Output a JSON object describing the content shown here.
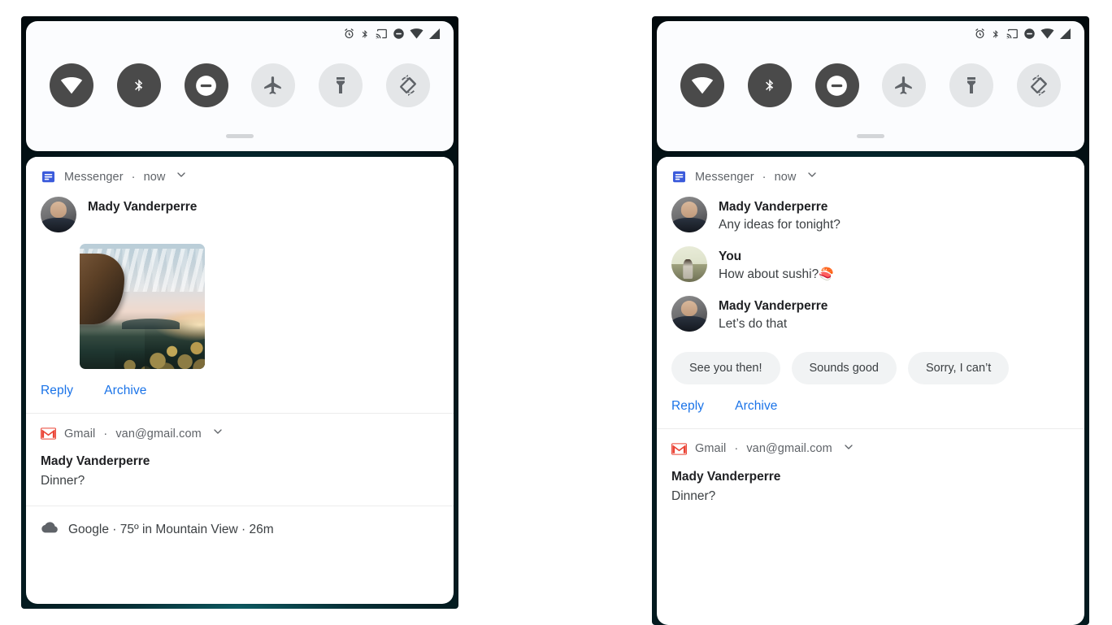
{
  "status_bar": {
    "icons": [
      "alarm-icon",
      "bluetooth-icon",
      "cast-icon",
      "do-not-disturb-icon",
      "wifi-icon",
      "signal-icon"
    ]
  },
  "quick_settings": {
    "tiles": [
      {
        "name": "wifi",
        "label": "Wi-Fi",
        "state": "on"
      },
      {
        "name": "bluetooth",
        "label": "Bluetooth",
        "state": "on"
      },
      {
        "name": "dnd",
        "label": "Do Not Disturb",
        "state": "on"
      },
      {
        "name": "airplane",
        "label": "Airplane mode",
        "state": "off"
      },
      {
        "name": "flashlight",
        "label": "Flashlight",
        "state": "off"
      },
      {
        "name": "auto-rotate",
        "label": "Auto-rotate",
        "state": "off"
      }
    ],
    "handle": "drag-handle"
  },
  "left_panel": {
    "messenger": {
      "app_name": "Messenger",
      "separator": "·",
      "time": "now",
      "sender": "Mady Vanderperre",
      "has_photo": true,
      "actions": [
        "Reply",
        "Archive"
      ]
    },
    "gmail": {
      "app_name": "Gmail",
      "separator": "·",
      "account": "van@gmail.com",
      "title": "Mady Vanderperre",
      "subject": "Dinner?"
    },
    "google": {
      "text": "Google · 75º in Mountain View · 26m"
    }
  },
  "right_panel": {
    "messenger": {
      "app_name": "Messenger",
      "separator": "·",
      "time": "now",
      "messages": [
        {
          "sender": "Mady Vanderperre",
          "text": "Any ideas for tonight?",
          "avatar": "mady"
        },
        {
          "sender": "You",
          "text": "How about sushi?",
          "emoji": "🍣",
          "avatar": "you"
        },
        {
          "sender": "Mady Vanderperre",
          "text": "Let’s do that",
          "avatar": "mady"
        }
      ],
      "smart_replies": [
        "See you then!",
        "Sounds good",
        "Sorry, I can’t"
      ],
      "actions": [
        "Reply",
        "Archive"
      ]
    },
    "gmail": {
      "app_name": "Gmail",
      "separator": "·",
      "account": "van@gmail.com",
      "title": "Mady Vanderperre",
      "subject": "Dinner?"
    }
  },
  "colors": {
    "accent_link": "#1a73e8",
    "tile_on": "#4a4a4a",
    "tile_off": "#e4e6e8",
    "gmail_red": "#ea4335",
    "messenger_blue": "#3b5bdb",
    "chip_bg": "#f1f3f4"
  }
}
